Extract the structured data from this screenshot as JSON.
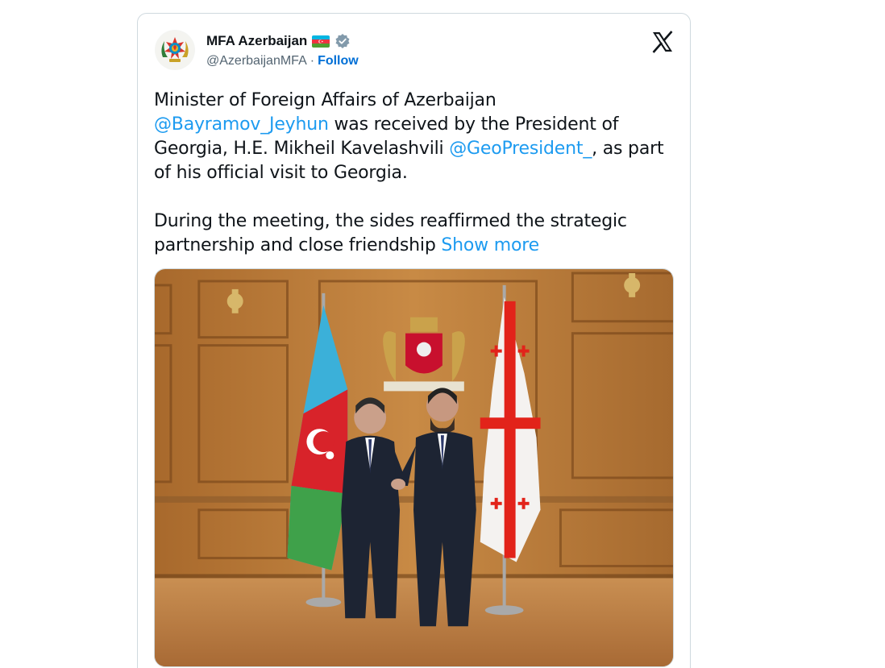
{
  "tweet": {
    "author": {
      "display_name": "MFA Azerbaijan",
      "handle": "@AzerbaijanMFA",
      "separator": "·",
      "follow_label": "Follow",
      "flag_icon": "azerbaijan-flag-icon",
      "verified_icon": "verified-badge-icon"
    },
    "platform_logo": "x-logo-icon",
    "text": {
      "p1_part1": "Minister of Foreign Affairs of Azerbaijan",
      "mention1": "@Bayramov_Jeyhun",
      "p1_part2": " was received by the President of Georgia, H.E. Mikheil Kavelashvili ",
      "mention2": "@GeoPresident_",
      "p1_part3": ", as part of his official visit to Georgia.",
      "p2": "During the meeting, the sides reaffirmed the strategic partnership and close friendship ",
      "show_more": "Show more"
    },
    "photo": {
      "subject": "two-officials-handshake-photo"
    }
  },
  "colors": {
    "link": "#1d9bf0",
    "follow": "#006fd6",
    "text": "#0f1419",
    "muted": "#536471",
    "border": "#cfd9de"
  }
}
